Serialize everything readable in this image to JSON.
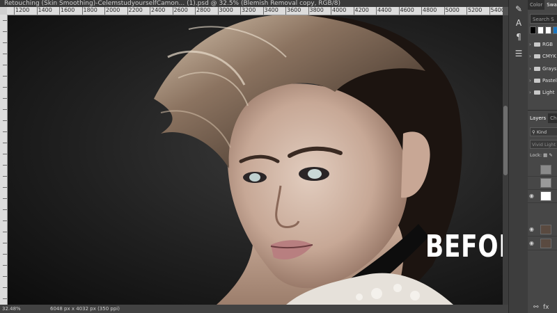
{
  "window": {
    "title": "Retouching (Skin Smoothing)-CelemstudyourselfCamon... (1).psd @ 32.5% (Blemish Removal copy, RGB/8)"
  },
  "ruler": {
    "top_labels": [
      "1200",
      "1400",
      "1600",
      "1800",
      "2000",
      "2200",
      "2400",
      "2600",
      "2800",
      "3000",
      "3200",
      "3400",
      "3600",
      "3800",
      "4000",
      "4200",
      "4400",
      "4600",
      "4800",
      "5000",
      "5200",
      "5400"
    ]
  },
  "canvas": {
    "overlay_text": "BEFORE"
  },
  "status": {
    "zoom": "32.48%",
    "document": "6048 px x 4032 px (350 ppi)"
  },
  "tools": {
    "icons": [
      "brush-settings-icon",
      "letter-a-icon",
      "paragraph-icon",
      "adjust-icon"
    ]
  },
  "swatches_panel": {
    "tabs": [
      "Color",
      "Swatches"
    ],
    "active_tab": "Swatches",
    "search_placeholder": "Search S",
    "swatch_colors": [
      "#000000",
      "#ffffff",
      "#ffffff",
      "#1b75bc"
    ],
    "folders": [
      "RGB",
      "CMYK",
      "Grays",
      "Pastel",
      "Light"
    ]
  },
  "layers_panel": {
    "tabs": [
      "Layers",
      "Channels"
    ],
    "active_tab": "Layers",
    "filter_label": "Kind",
    "blend_mode": "Vivid Light",
    "lock_label": "Lock:"
  },
  "colors": {
    "background": "#535353",
    "panel": "#474747",
    "ruler": "#dcdcdc"
  }
}
